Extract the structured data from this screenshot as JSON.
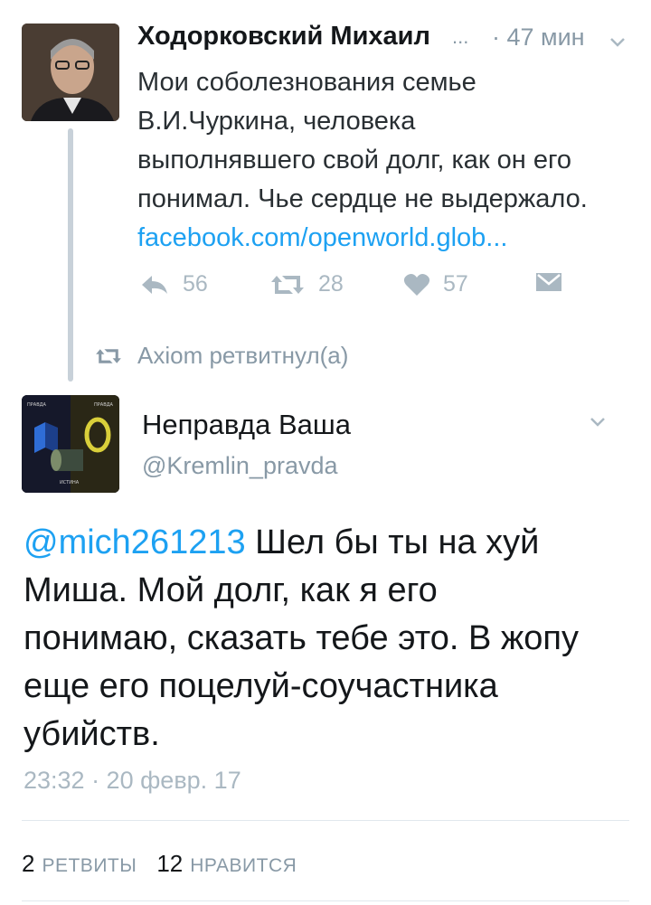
{
  "tweet1": {
    "author": "Ходорковский Михаил",
    "ellipsis": "...",
    "time_ago": "· 47 мин",
    "lines": [
      "Мои соболезнования семье",
      "В.И.Чуркина, человека",
      "выполнявшего свой долг, как он его",
      "понимал. Чье сердце не выдержало."
    ],
    "link": "facebook.com/openworld.glob...",
    "replies": "56",
    "retweets": "28",
    "likes": "57"
  },
  "retweet_note": "Axiom ретвитнул(а)",
  "tweet2": {
    "avatar_labels": {
      "top_left": "ПРАВДА",
      "top_right": "ПРАВДА",
      "bottom": "ИСТИНА"
    },
    "name": "Неправда Ваша",
    "handle": "@Kremlin_pravda",
    "mention": "@mich261213",
    "lines": [
      " Шел бы ты на хуй",
      "Миша. Мой долг, как я его",
      "понимаю, сказать тебе это. В жопу",
      "еще его поцелуй-соучастника",
      "убийств."
    ],
    "timestamp": "23:32 · 20 февр. 17",
    "stats": {
      "retweets_count": "2",
      "retweets_label": "РЕТВИТЫ",
      "likes_count": "12",
      "likes_label": "НРАВИТСЯ"
    }
  },
  "colors": {
    "link": "#1da1f2",
    "muted": "#8899a6",
    "icon": "#aab8c2",
    "thread_line": "#c8d1d9"
  }
}
